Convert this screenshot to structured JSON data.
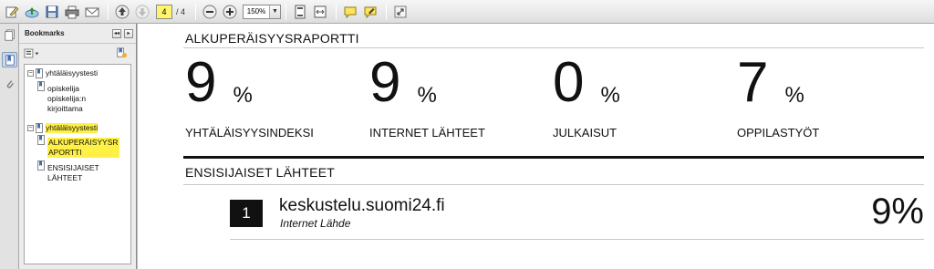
{
  "toolbar": {
    "page_current": "4",
    "page_total": "/ 4",
    "zoom": "150%",
    "icons": [
      "edit-icon",
      "upload-icon",
      "save-icon",
      "print-icon",
      "email-icon",
      "prev-page-icon",
      "next-page-icon",
      "zoom-out-icon",
      "zoom-in-icon",
      "fit-page-icon",
      "fit-width-icon",
      "comment-icon",
      "highlight-icon",
      "expand-icon"
    ]
  },
  "bookmarks": {
    "title": "Bookmarks",
    "items": [
      {
        "label": "yhtäläisyystesti",
        "level": 0
      },
      {
        "label": "opiskelija\nopiskelija:n\nkirjoittama",
        "level": 1
      },
      {
        "label": "yhtäläisyystesti",
        "level": 0,
        "highlighted": true
      },
      {
        "label": "ALKUPERÄISYYSR\nAPORTTI",
        "level": 1,
        "highlighted": true,
        "selected": true
      },
      {
        "label": "ENSISIJAISET\nLÄHTEET",
        "level": 1
      }
    ]
  },
  "report": {
    "title": "ALKUPERÄISYYSRAPORTTI",
    "stats": [
      {
        "value": "9",
        "unit": "%",
        "caption": "YHTÄLÄISYYSINDEKSI"
      },
      {
        "value": "9",
        "unit": "%",
        "caption": "INTERNET LÄHTEET"
      },
      {
        "value": "0",
        "unit": "%",
        "caption": "JULKAISUT"
      },
      {
        "value": "7",
        "unit": "%",
        "caption": "OPPILASTYÖT"
      }
    ],
    "primary_sources_title": "ENSISIJAISET LÄHTEET",
    "source": {
      "number": "1",
      "name": "keskustelu.suomi24.fi",
      "type": "Internet Lähde",
      "percent": "9%"
    }
  }
}
